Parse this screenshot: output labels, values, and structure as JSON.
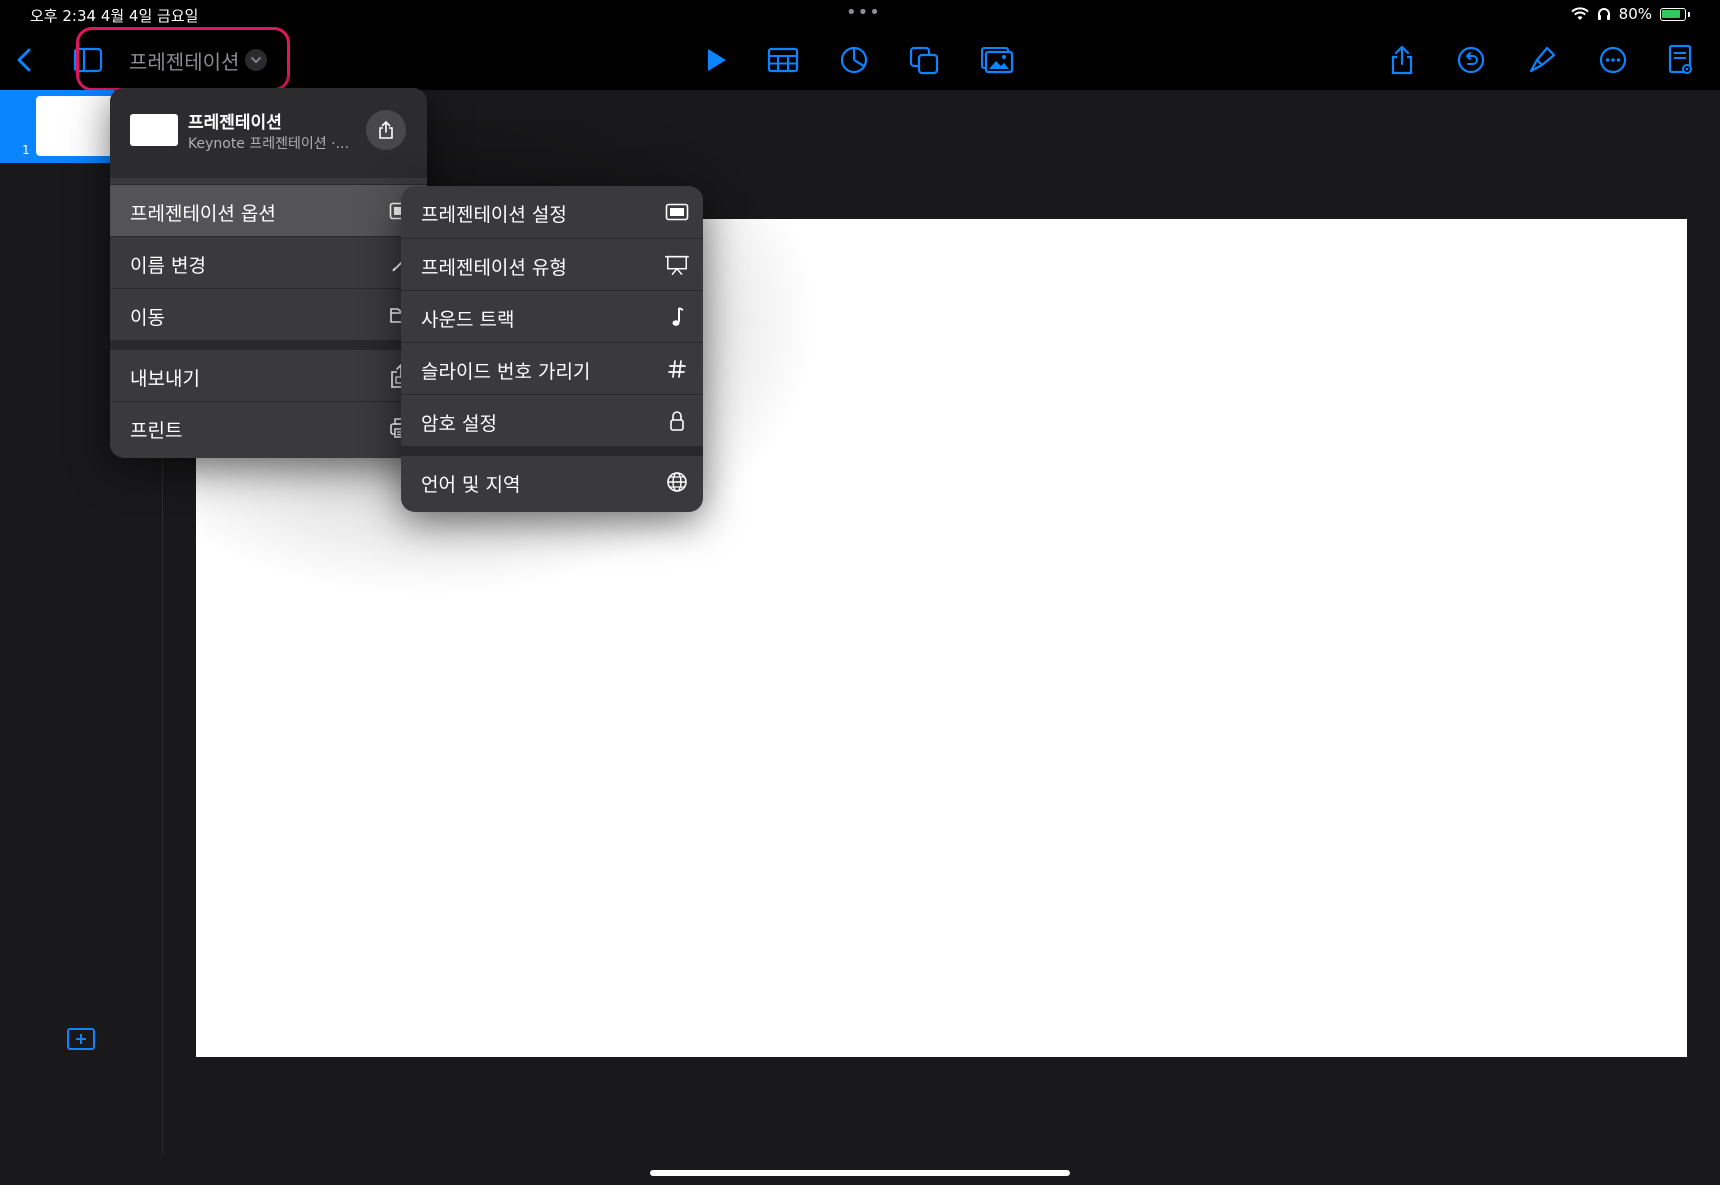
{
  "status_bar": {
    "time_date": "오후 2:34   4월 4일 금요일",
    "battery": "80%"
  },
  "toolbar": {
    "document_title": "프레젠테이션"
  },
  "sidebar": {
    "slide_number": "1"
  },
  "file_menu": {
    "header_title": "프레젠테이션",
    "header_subtitle": "Keynote 프레젠테이션 ·...",
    "items": [
      {
        "label": "프레젠테이션 옵션",
        "icon": "presentation-screen-icon"
      },
      {
        "label": "이름 변경",
        "icon": "pencil-icon"
      },
      {
        "label": "이동",
        "icon": "folder-icon"
      },
      {
        "label": "내보내기",
        "icon": "export-icon"
      },
      {
        "label": "프린트",
        "icon": "printer-icon"
      }
    ]
  },
  "presentation_options_submenu": {
    "items": [
      {
        "label": "프레젠테이션 설정",
        "icon": "presentation-screen-icon"
      },
      {
        "label": "프레젠테이션 유형",
        "icon": "easel-icon"
      },
      {
        "label": "사운드 트랙",
        "icon": "music-note-icon"
      },
      {
        "label": "슬라이드 번호 가리기",
        "icon": "hashtag-icon"
      },
      {
        "label": "암호 설정",
        "icon": "lock-icon"
      },
      {
        "label": "언어 및 지역",
        "icon": "globe-icon"
      }
    ]
  },
  "colors": {
    "accent": "#0a84ff",
    "highlight_border": "#e0175f",
    "menu_bg": "#3a3a3c"
  }
}
